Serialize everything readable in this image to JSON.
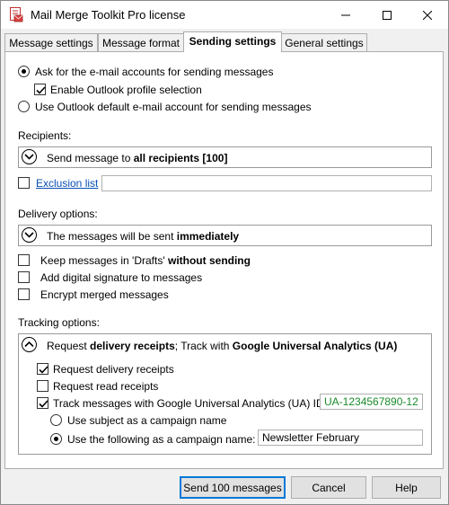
{
  "window": {
    "title": "Mail Merge Toolkit Pro license"
  },
  "tabs": [
    {
      "label": "Message settings"
    },
    {
      "label": "Message format"
    },
    {
      "label": "Sending settings"
    },
    {
      "label": "General settings"
    }
  ],
  "accounts": {
    "ask_label": "Ask for the e-mail accounts for sending messages",
    "ask_selected": true,
    "enable_profile_label": "Enable Outlook profile selection",
    "enable_profile_checked": true,
    "default_label": "Use Outlook default e-mail account for sending messages",
    "default_selected": false
  },
  "recipients": {
    "heading": "Recipients:",
    "summary_prefix": "Send message to ",
    "summary_bold": "all recipients [100]",
    "exclusion_label": "Exclusion list",
    "exclusion_checked": false,
    "exclusion_value": ""
  },
  "delivery": {
    "heading": "Delivery options:",
    "summary_prefix": "The messages will be sent ",
    "summary_bold": "immediately",
    "drafts_prefix": "Keep messages in 'Drafts' ",
    "drafts_bold": "without sending",
    "drafts_checked": false,
    "signature_label": "Add digital signature to messages",
    "signature_checked": false,
    "encrypt_label": "Encrypt merged messages",
    "encrypt_checked": false
  },
  "tracking": {
    "heading": "Tracking options:",
    "summary_p1": "Request ",
    "summary_b1": "delivery receipts",
    "summary_p2": "; Track with ",
    "summary_b2": "Google Universal Analytics (UA)",
    "delivery_receipts_label": "Request delivery receipts",
    "delivery_receipts_checked": true,
    "read_receipts_label": "Request read receipts",
    "read_receipts_checked": false,
    "ua_label": "Track messages with Google Universal Analytics (UA) ID",
    "ua_checked": true,
    "ua_id": "UA-1234567890-12",
    "subject_campaign_label": "Use subject as a campaign name",
    "subject_campaign_selected": false,
    "custom_campaign_label": "Use the following as a campaign name:",
    "custom_campaign_selected": true,
    "campaign_name": "Newsletter February"
  },
  "buttons": {
    "send_label": "Send 100 messages",
    "cancel_label": "Cancel",
    "help_label": "Help"
  },
  "colors": {
    "accent": "#0078d7",
    "link": "#0a50b4",
    "ua_id_text": "#1a8a2a"
  }
}
